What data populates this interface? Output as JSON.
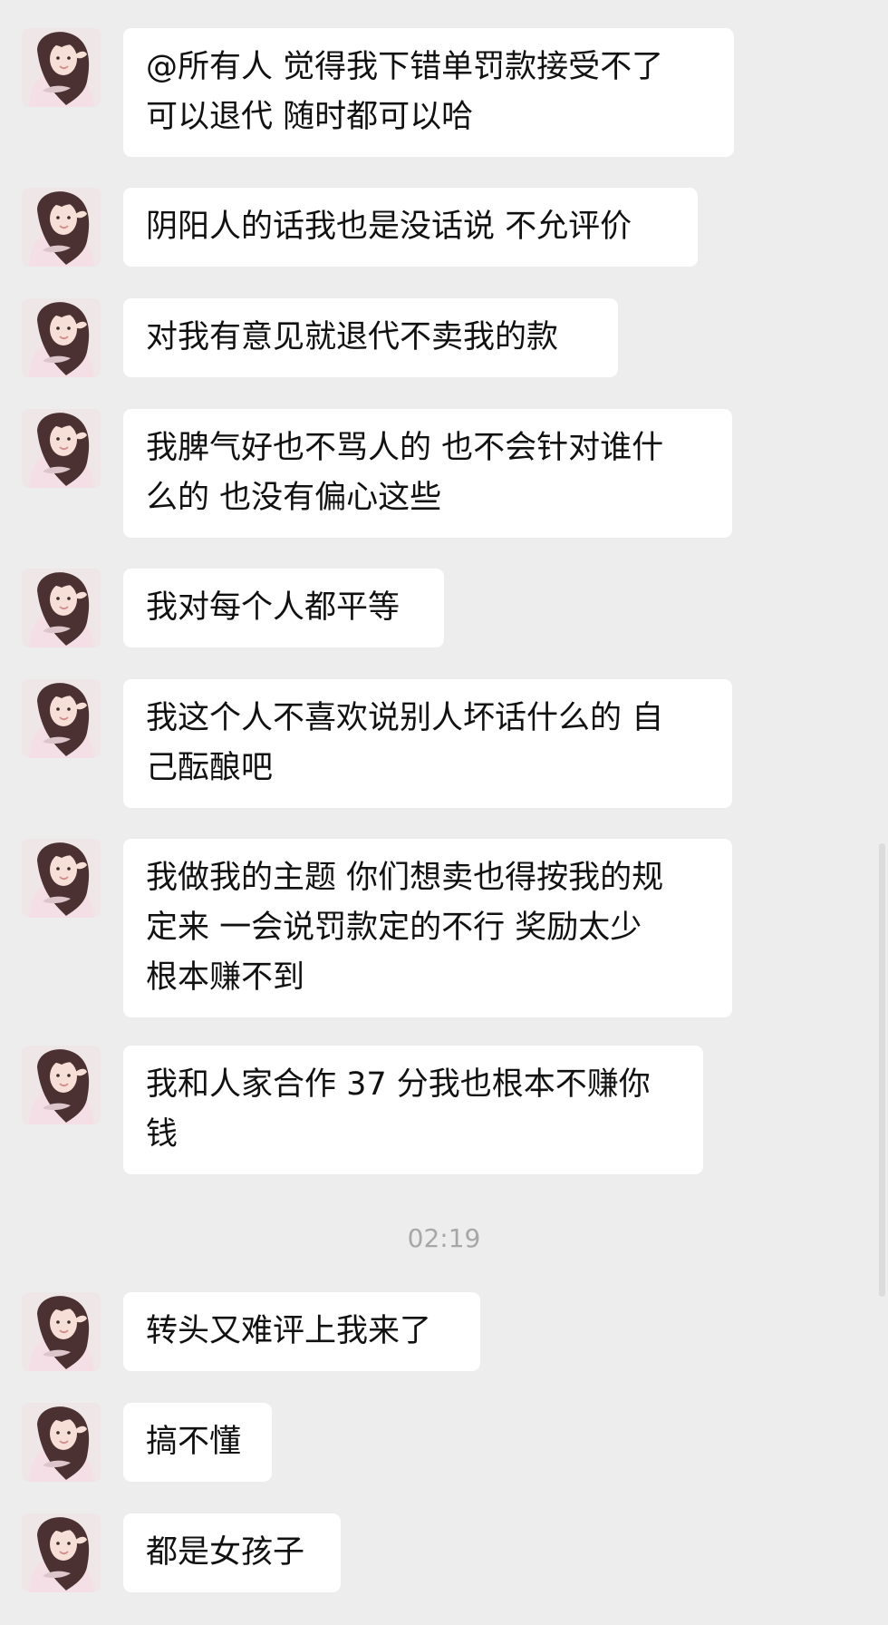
{
  "timestamp": "02:19",
  "avatar": {
    "icon": "profile-photo-avatar",
    "hair": "#4b3131",
    "skin": "#f6dfd6",
    "shirt": "#f4dfe6",
    "background": "#efe6e7"
  },
  "messages": [
    {
      "lines": [
        "@所有人 觉得我下错单罚款接受不了",
        "可以退代 随时都可以哈"
      ]
    },
    {
      "lines": [
        "阴阳人的话我也是没话说 不允评价"
      ]
    },
    {
      "lines": [
        "对我有意见就退代不卖我的款"
      ]
    },
    {
      "lines": [
        "我脾气好也不骂人的 也不会针对谁什",
        "么的 也没有偏心这些"
      ]
    },
    {
      "lines": [
        "我对每个人都平等"
      ]
    },
    {
      "lines": [
        "我这个人不喜欢说别人坏话什么的 自",
        "己酝酿吧"
      ]
    },
    {
      "lines": [
        "我做我的主题 你们想卖也得按我的规",
        "定来 一会说罚款定的不行 奖励太少",
        "根本赚不到"
      ]
    },
    {
      "lines": [
        "我和人家合作 37 分我也根本不赚你",
        "钱"
      ]
    },
    {
      "lines": [
        "转头又难评上我来了"
      ]
    },
    {
      "lines": [
        "搞不懂"
      ]
    },
    {
      "lines": [
        "都是女孩子"
      ]
    }
  ]
}
